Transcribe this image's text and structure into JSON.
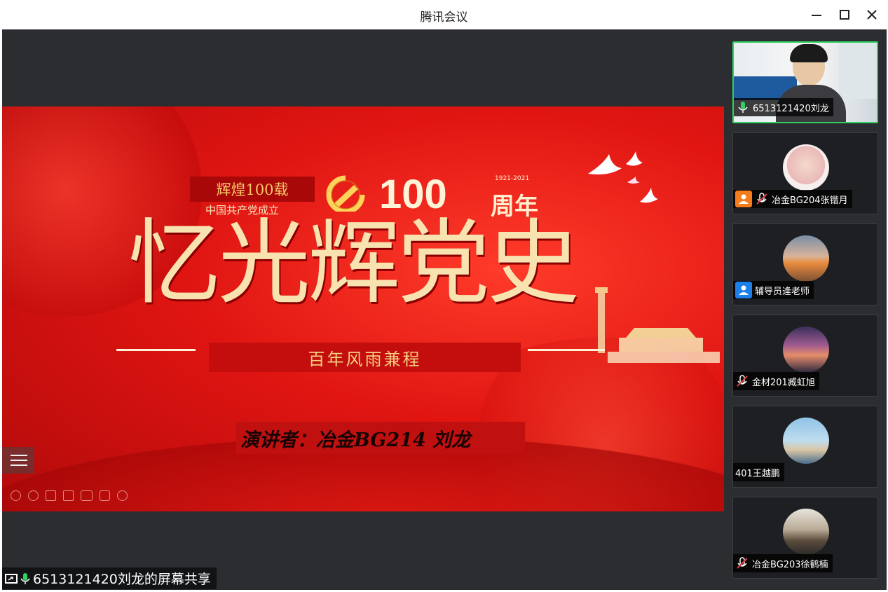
{
  "window": {
    "title": "腾讯会议"
  },
  "slide": {
    "badge": "辉煌100载",
    "founding": "中国共产党成立",
    "hundred": "100",
    "years": "1921-2021",
    "anniversary": "周年",
    "main_title": "忆光辉党史",
    "subtitle": "百年风雨兼程",
    "speaker": "演讲者：冶金BG214 刘龙"
  },
  "share_label": "6513121420刘龙的屏幕共享",
  "participants": [
    {
      "name": "6513121420刘龙",
      "mic": "on",
      "has_video": true
    },
    {
      "name": "冶金BG204张锴月",
      "mic": "muted",
      "user_icon": "orange"
    },
    {
      "name": "辅导员逄老师",
      "mic": "none",
      "user_icon": "blue"
    },
    {
      "name": "金材201臧虹旭",
      "mic": "muted"
    },
    {
      "name": "401王越鹏",
      "mic": "none"
    },
    {
      "name": "冶金BG203徐鹤楠",
      "mic": "muted"
    }
  ],
  "colors": {
    "active_border": "#2fd160",
    "slide_red": "#e01512",
    "gold": "#f8e3b0"
  }
}
